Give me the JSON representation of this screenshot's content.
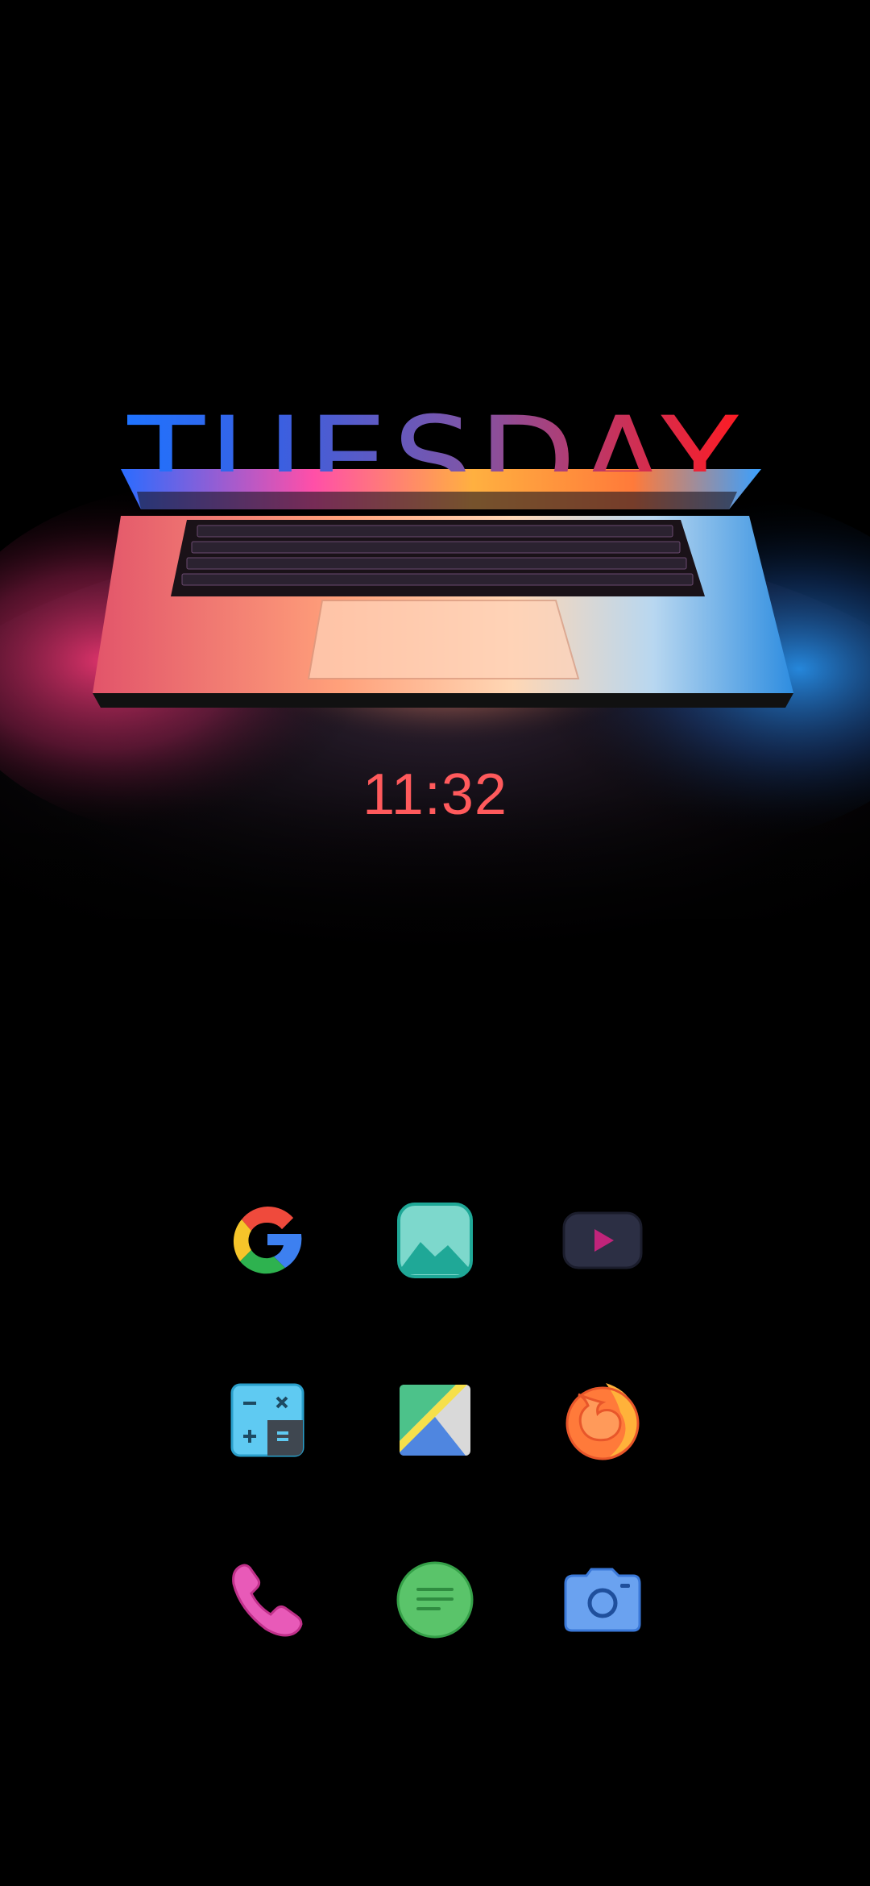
{
  "lockscreen": {
    "day": "TUESDAY",
    "time": "11:32"
  },
  "apps": [
    {
      "id": "google",
      "icon": "google-icon"
    },
    {
      "id": "gallery",
      "icon": "gallery-icon"
    },
    {
      "id": "video",
      "icon": "video-player-icon"
    },
    {
      "id": "calculator",
      "icon": "calculator-icon"
    },
    {
      "id": "maps",
      "icon": "maps-icon"
    },
    {
      "id": "firefox",
      "icon": "firefox-icon"
    },
    {
      "id": "phone",
      "icon": "phone-icon"
    },
    {
      "id": "messages",
      "icon": "messages-icon"
    },
    {
      "id": "camera",
      "icon": "camera-icon"
    }
  ],
  "colors": {
    "clock": "#ff5a5c",
    "day_gradient_start": "#1f73ff",
    "day_gradient_end": "#ff1b22",
    "background": "#000000"
  }
}
